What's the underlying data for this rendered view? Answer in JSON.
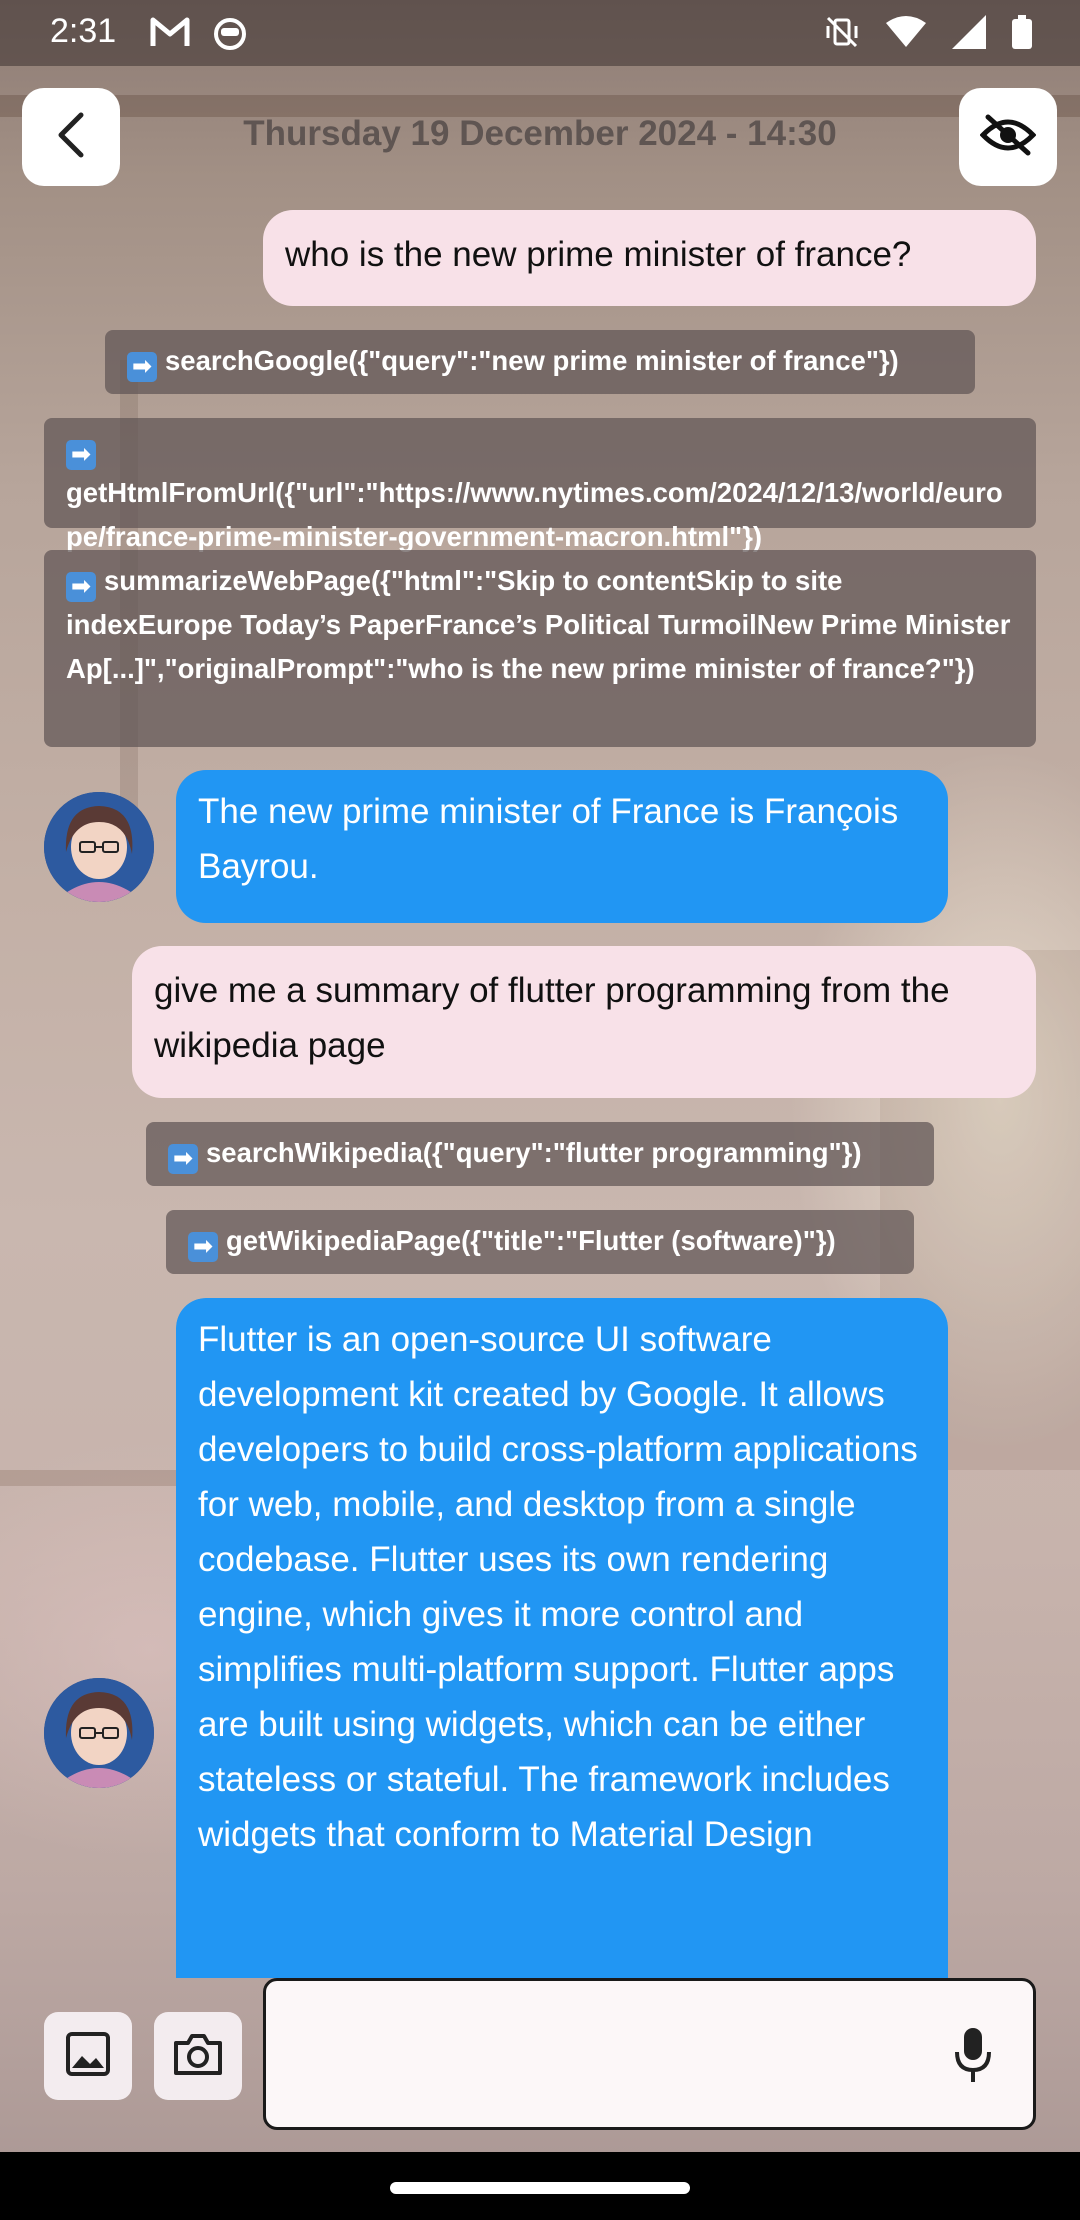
{
  "status_bar": {
    "time": "2:31",
    "left_icons": [
      "gmail-icon",
      "cat-face-icon"
    ],
    "right_icons": [
      "vibrate-off-icon",
      "wifi-icon",
      "cellular-signal-icon",
      "battery-icon"
    ]
  },
  "header": {
    "title": "Thursday 19 December 2024 - 14:30",
    "back_icon": "chevron-left-icon",
    "visibility_icon": "eye-off-icon"
  },
  "messages": [
    {
      "role": "user",
      "text": "who is the new prime minister of france?"
    },
    {
      "role": "tool",
      "text": "searchGoogle({\"query\":\"new prime minister of france\"})"
    },
    {
      "role": "tool",
      "text": "getHtmlFromUrl({\"url\":\"https://www.nytimes.com/2024/12/13/world/europe/france-prime-minister-government-macron.html\"})"
    },
    {
      "role": "tool",
      "text": "summarizeWebPage({\"html\":\"Skip to contentSkip to site indexEurope Today’s PaperFrance’s Political TurmoilNew Prime Minister Ap[...]\",\"originalPrompt\":\"who is the new prime minister of france?\"})"
    },
    {
      "role": "assistant",
      "text": "The new prime minister of France is François Bayrou."
    },
    {
      "role": "user",
      "text": "give me a summary of flutter programming from the wikipedia page"
    },
    {
      "role": "tool",
      "text": "searchWikipedia({\"query\":\"flutter programming\"})"
    },
    {
      "role": "tool",
      "text": "getWikipediaPage({\"title\":\"Flutter (software)\"})"
    },
    {
      "role": "assistant",
      "text": "Flutter is an open-source UI software development kit created by Google. It allows developers to build cross-platform applications for web, mobile, and desktop from a single codebase. Flutter uses its own rendering engine, which gives it more control and simplifies multi-platform support. Flutter apps are built using widgets, which can be either stateless or stateful. The framework includes widgets that conform to Material Design"
    }
  ],
  "tool_prefix": "➡",
  "composer": {
    "placeholder": "",
    "value": "",
    "image_icon": "image-icon",
    "camera_icon": "camera-icon",
    "mic_icon": "microphone-icon"
  },
  "colors": {
    "user_bubble": "#f8e1e8",
    "assistant_bubble": "#2196f3",
    "tool_chip": "#5f5555"
  }
}
